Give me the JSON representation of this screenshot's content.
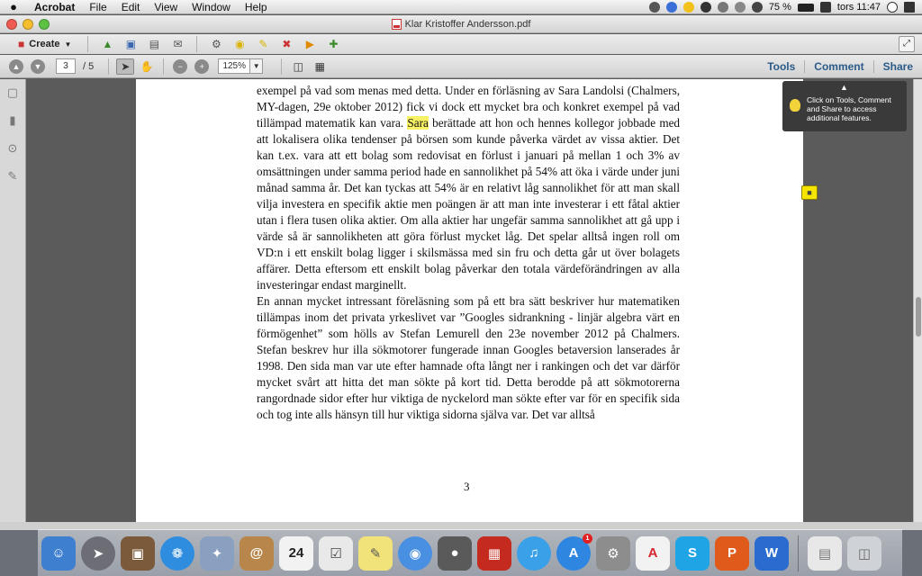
{
  "menubar": {
    "apple": "",
    "items": [
      "Acrobat",
      "File",
      "Edit",
      "View",
      "Window",
      "Help"
    ],
    "battery": "75 %",
    "clock": "tors 11:47"
  },
  "window": {
    "title": "Klar Kristoffer Andersson.pdf"
  },
  "toolbar": {
    "create_label": "Create"
  },
  "nav": {
    "page_current": "3",
    "page_total": "/ 5",
    "zoom": "125%",
    "tools_label": "Tools",
    "comment_label": "Comment",
    "share_label": "Share"
  },
  "tooltip": {
    "text": "Click on Tools, Comment and Share to access additional features."
  },
  "document": {
    "para1_before": "exempel på vad som menas med detta. Under en förläsning av Sara Landolsi (Chalmers, MY-dagen, 29e oktober 2012) fick vi dock ett mycket bra och konkret exempel på vad tillämpad matematik kan vara.",
    "para1_highlight": "Sara",
    "para1_after": "berättade att hon och hennes kollegor jobbade med att lokalisera olika tendenser på börsen som kunde påverka värdet av vissa aktier. Det kan t.ex. vara att ett bolag som redovisat en förlust i januari på mellan 1 och 3% av omsättningen under samma period hade en sannolikhet på 54% att öka i värde under juni månad samma år. Det kan tyckas att 54% är en relativt låg sannolikhet för att man skall vilja investera en specifik aktie men poängen är att man inte investerar i ett fåtal aktier utan i flera tusen olika aktier. Om alla aktier har ungefär samma sannolikhet att gå upp i värde så är sannolikheten att göra förlust mycket låg. Det spelar alltså ingen roll om VD:n i ett enskilt bolag ligger i skilsmässa med sin fru och detta går ut över bolagets affärer. Detta eftersom ett enskilt bolag påverkar den totala värdeförändringen av alla investeringar endast marginellt.",
    "para2": "En annan mycket intressant föreläsning som på ett bra sätt beskriver hur matematiken tillämpas inom det privata yrkeslivet var ”Googles sidrankning - linjär algebra värt en förmögenhet” som hölls av Stefan Lemurell den 23e november 2012 på Chalmers. Stefan beskrev hur illa sökmotorer fungerade innan Googles betaversion lanserades år 1998. Den sida man var ute efter hamnade ofta långt ner i rankingen och det var därför mycket svårt att hitta det man sökte på kort tid. Detta berodde på att sökmotorerna rangordnade sidor efter hur viktiga de nyckelord man sökte efter var för en specifik sida och tog inte alls hänsyn till hur viktiga sidorna själva var. Det var alltså",
    "page_number": "3"
  },
  "dock": {
    "calendar_day": "24",
    "appstore_badge": "1"
  },
  "colors": {
    "highlight": "#f7f264",
    "link": "#2b5b8a",
    "close": "#ee5b52",
    "minimize": "#f4be2e",
    "zoom": "#5dc244"
  }
}
